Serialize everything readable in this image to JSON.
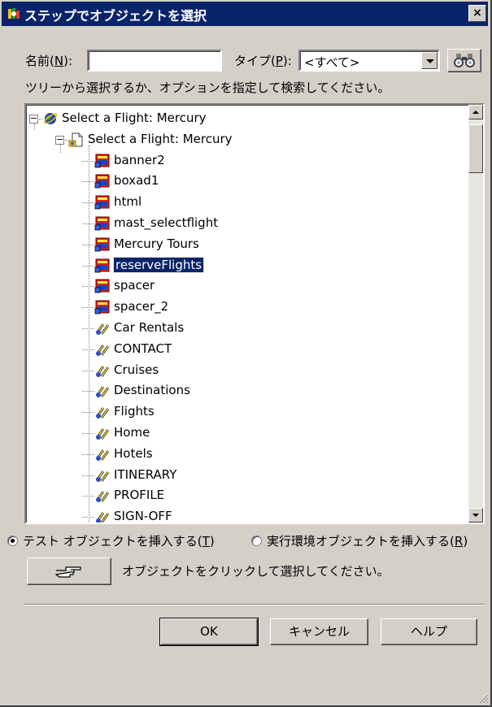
{
  "window": {
    "title": "ステップでオブジェクトを選択",
    "close_label": "×"
  },
  "search": {
    "name_label": "名前",
    "name_hotkey": "N",
    "name_value": "",
    "type_label": "タイプ",
    "type_hotkey": "P",
    "type_value": "<すべて>",
    "instruction": "ツリーから選択するか、オプションを指定して検索してください。"
  },
  "tree": {
    "root": "Select a Flight: Mercury",
    "page": "Select a Flight: Mercury",
    "items": [
      {
        "label": "banner2",
        "icon": "image-icon"
      },
      {
        "label": "boxad1",
        "icon": "image-icon"
      },
      {
        "label": "html",
        "icon": "image-icon"
      },
      {
        "label": "mast_selectflight",
        "icon": "image-icon"
      },
      {
        "label": "Mercury Tours",
        "icon": "image-icon"
      },
      {
        "label": "reserveFlights",
        "icon": "image-icon",
        "selected": true
      },
      {
        "label": "spacer",
        "icon": "image-icon"
      },
      {
        "label": "spacer_2",
        "icon": "image-icon"
      },
      {
        "label": "Car Rentals",
        "icon": "link-icon"
      },
      {
        "label": "CONTACT",
        "icon": "link-icon"
      },
      {
        "label": "Cruises",
        "icon": "link-icon"
      },
      {
        "label": "Destinations",
        "icon": "link-icon"
      },
      {
        "label": "Flights",
        "icon": "link-icon"
      },
      {
        "label": "Home",
        "icon": "link-icon"
      },
      {
        "label": "Hotels",
        "icon": "link-icon"
      },
      {
        "label": "ITINERARY",
        "icon": "link-icon"
      },
      {
        "label": "PROFILE",
        "icon": "link-icon"
      },
      {
        "label": "SIGN-OFF",
        "icon": "link-icon"
      }
    ]
  },
  "options": {
    "test_object_label": "テスト オブジェクトを挿入する",
    "test_object_hotkey": "T",
    "test_object_selected": true,
    "runtime_object_label": "実行環境オブジェクトを挿入する",
    "runtime_object_hotkey": "R",
    "runtime_object_selected": false
  },
  "pointer": {
    "hint": "オブジェクトをクリックして選択してください。"
  },
  "buttons": {
    "ok": "OK",
    "cancel": "キャンセル",
    "help": "ヘルプ"
  }
}
